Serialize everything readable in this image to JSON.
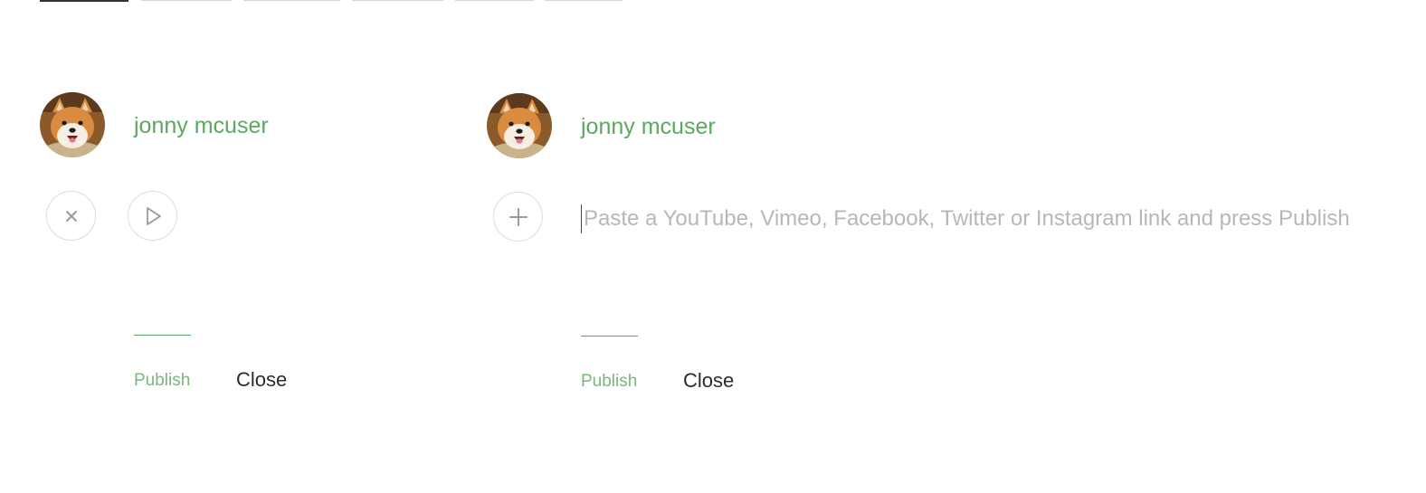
{
  "tabs": [
    {
      "active": true
    },
    {
      "active": false
    },
    {
      "active": false
    },
    {
      "active": false
    },
    {
      "active": false
    },
    {
      "active": false
    }
  ],
  "composer_left": {
    "user_name": "jonny mcuser",
    "avatar_icon": "shiba-dog-avatar",
    "action_icons": [
      "close-icon",
      "play-icon"
    ],
    "publish_label": "Publish",
    "close_label": "Close"
  },
  "composer_right": {
    "user_name": "jonny mcuser",
    "avatar_icon": "shiba-dog-avatar",
    "action_icons": [
      "plus-icon"
    ],
    "link_input": {
      "value": "",
      "placeholder": "Paste a YouTube, Vimeo, Facebook, Twitter or Instagram link and press Publish"
    },
    "publish_label": "Publish",
    "close_label": "Close"
  },
  "colors": {
    "accent_green": "#5aa95f",
    "publish_green": "#7ab67e",
    "placeholder_gray": "#b7b7b7",
    "icon_gray": "#9a9a9a",
    "border_gray": "#dcdcdc"
  }
}
